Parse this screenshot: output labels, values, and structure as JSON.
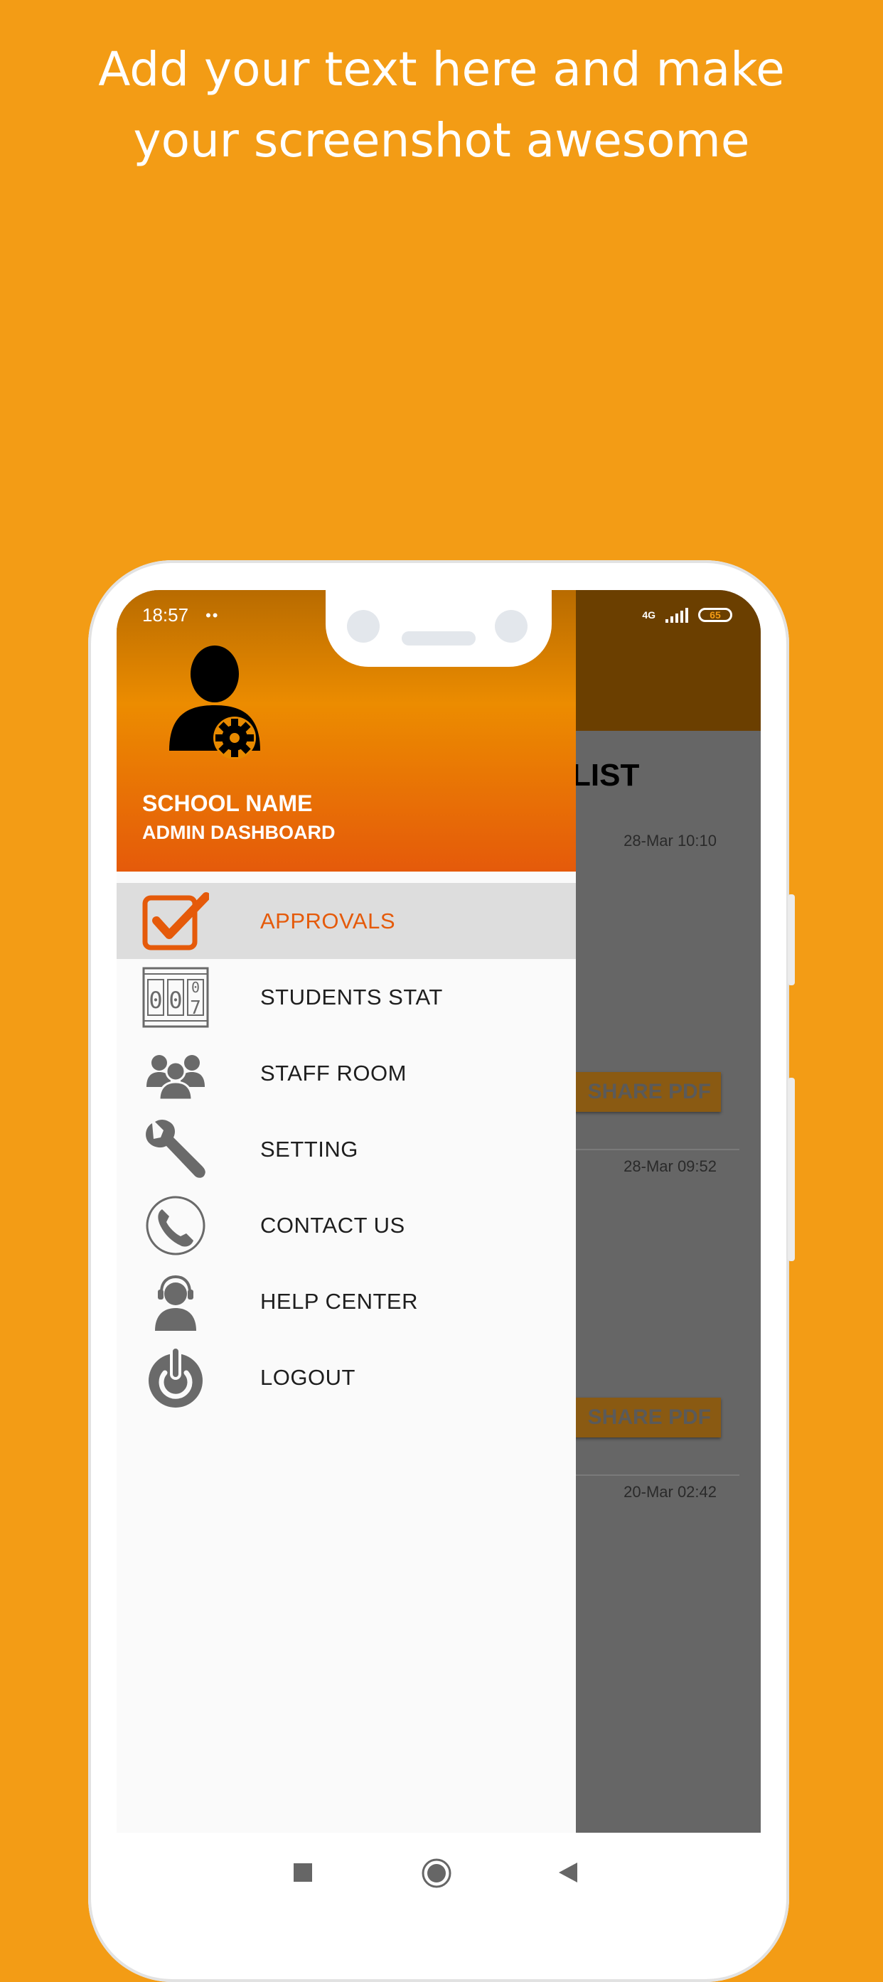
{
  "promo": {
    "line1": "Add your text here and make",
    "line2": "your screenshot awesome"
  },
  "status_bar": {
    "time": "18:57",
    "dots": "••",
    "network": "4G",
    "battery": "65"
  },
  "background_screen": {
    "title_fragment": "LIST",
    "entries": [
      {
        "date": "28-Mar 10:10",
        "button": "SHARE PDF"
      },
      {
        "date": "28-Mar 09:52",
        "button": "SHARE PDF"
      },
      {
        "date": "20-Mar 02:42"
      }
    ]
  },
  "drawer": {
    "school_name": "SCHOOL NAME",
    "subtitle": "ADMIN DASHBOARD",
    "active_color": "#E55A0A",
    "items": [
      {
        "label": "APPROVALS",
        "icon": "approval-checkbox-icon",
        "active": true
      },
      {
        "label": "STUDENTS STAT",
        "icon": "counter-icon"
      },
      {
        "label": "STAFF ROOM",
        "icon": "staff-group-icon"
      },
      {
        "label": "SETTING",
        "icon": "wrench-icon"
      },
      {
        "label": "CONTACT US",
        "icon": "phone-icon"
      },
      {
        "label": "HELP CENTER",
        "icon": "support-agent-icon"
      },
      {
        "label": "LOGOUT",
        "icon": "power-icon"
      }
    ]
  },
  "counter_digits": [
    "0",
    "0",
    "7",
    "0"
  ],
  "navigation": {
    "buttons": [
      "recent-apps-icon",
      "home-icon",
      "back-icon"
    ]
  }
}
